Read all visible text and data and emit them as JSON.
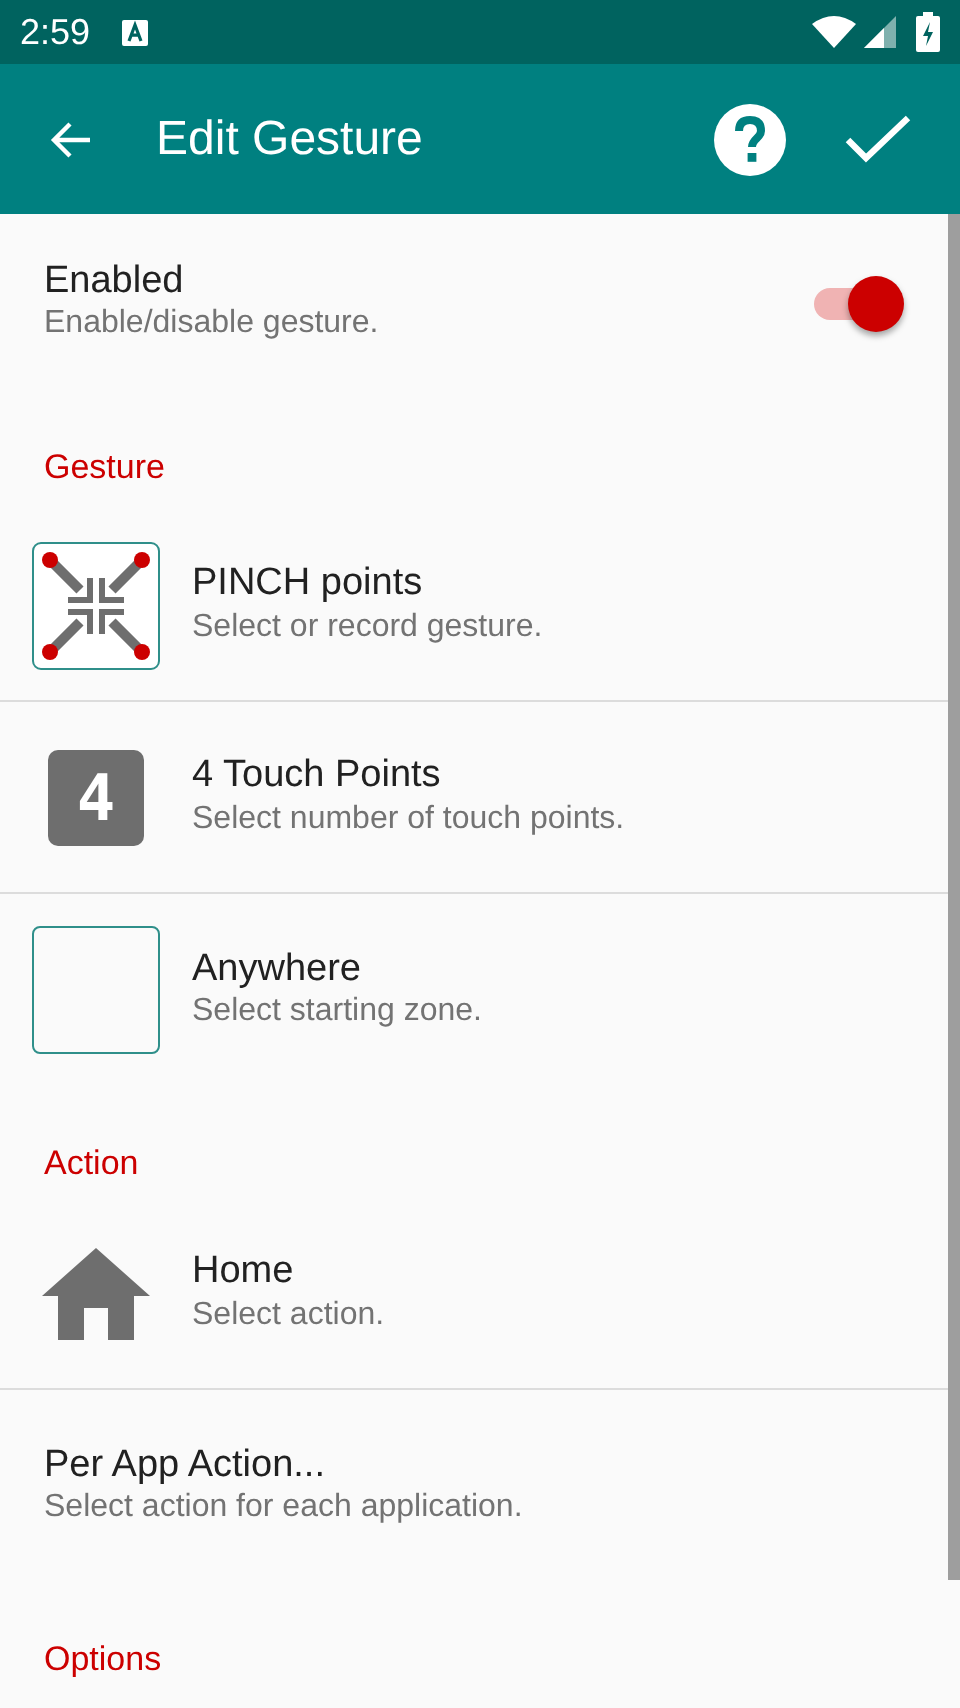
{
  "status_bar": {
    "time": "2:59"
  },
  "app_bar": {
    "title": "Edit Gesture"
  },
  "settings": [
    {
      "kind": "switch",
      "title": "Enabled",
      "summary": "Enable/disable gesture.",
      "on": true
    },
    {
      "kind": "header",
      "title": "Gesture"
    },
    {
      "kind": "pinch",
      "title": "PINCH points",
      "summary": "Select or record gesture."
    },
    {
      "kind": "number",
      "icon_text": "4",
      "title": "4 Touch Points",
      "summary": "Select number of touch points."
    },
    {
      "kind": "zone",
      "title": "Anywhere",
      "summary": "Select starting zone."
    },
    {
      "kind": "header",
      "title": "Action"
    },
    {
      "kind": "home",
      "title": "Home",
      "summary": "Select action."
    },
    {
      "kind": "plain",
      "title": "Per App Action...",
      "summary": "Select action for each application."
    },
    {
      "kind": "header",
      "title": "Options"
    }
  ]
}
